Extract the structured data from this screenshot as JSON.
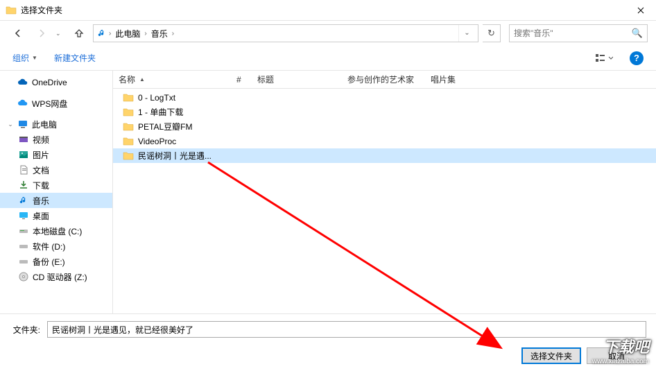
{
  "title": "选择文件夹",
  "breadcrumb": {
    "seg1": "此电脑",
    "seg2": "音乐"
  },
  "search": {
    "placeholder": "搜索\"音乐\""
  },
  "toolbar": {
    "organize": "组织",
    "newfolder": "新建文件夹"
  },
  "tree": {
    "onedrive": "OneDrive",
    "wps": "WPS网盘",
    "thispc": "此电脑",
    "video": "视频",
    "pictures": "图片",
    "documents": "文档",
    "downloads": "下载",
    "music": "音乐",
    "desktop": "桌面",
    "c": "本地磁盘 (C:)",
    "d": "软件 (D:)",
    "e": "备份 (E:)",
    "cd": "CD 驱动器 (Z:)"
  },
  "columns": {
    "name": "名称",
    "num": "#",
    "title": "标题",
    "artist": "参与创作的艺术家",
    "album": "唱片集"
  },
  "files": {
    "f0": "0 - LogTxt",
    "f1": "1 - 单曲下载",
    "f2": "PETAL豆瓣FM",
    "f3": "VideoProc",
    "f4": "民谣树洞丨光是遇..."
  },
  "folder_label": "文件夹:",
  "folder_value": "民谣树洞丨光是遇见，就已经很美好了",
  "buttons": {
    "select": "选择文件夹",
    "cancel": "取消"
  },
  "watermark": "下载吧",
  "watermark_sub": "www.xiazaiba.com"
}
